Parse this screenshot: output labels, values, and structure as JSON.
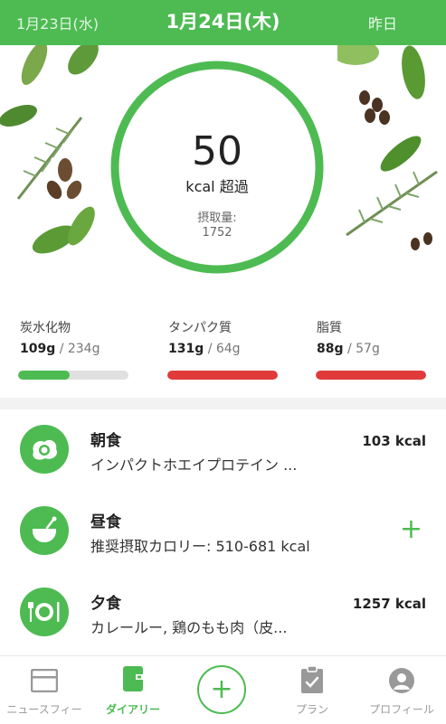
{
  "header": {
    "prev_date": "1月23日(水)",
    "current_date": "1月24日(木)",
    "yesterday_label": "昨日"
  },
  "summary": {
    "value": "50",
    "unit_label": "kcal 超過",
    "intake_label": "摂取量:",
    "intake_value": "1752",
    "ring_color": "#4dbb52"
  },
  "macros": [
    {
      "name": "炭水化物",
      "amount": "109g",
      "goal": " / 234g",
      "progress": 0.47,
      "color": "#4dbb52"
    },
    {
      "name": "タンパク質",
      "amount": "131g",
      "goal": " / 64g",
      "progress": 1.0,
      "color": "#e03a3a"
    },
    {
      "name": "脂質",
      "amount": "88g",
      "goal": " / 57g",
      "progress": 1.0,
      "color": "#e03a3a"
    }
  ],
  "meals": [
    {
      "title": "朝食",
      "subtitle": "インパクトホエイプロテイン ...",
      "kcal": "103 kcal",
      "icon": "egg-icon"
    },
    {
      "title": "昼食",
      "subtitle": "推奨摂取カロリー: 510-681 kcal",
      "action": "+",
      "icon": "bowl-icon"
    },
    {
      "title": "夕食",
      "subtitle": "カレールー, 鶏のもも肉（皮...",
      "kcal": "1257 kcal",
      "icon": "plate-icon"
    }
  ],
  "nav": {
    "items": [
      {
        "label": "ニュースフィー",
        "icon": "newsfeed-icon"
      },
      {
        "label": "ダイアリー",
        "icon": "diary-icon"
      },
      {
        "label": "+",
        "icon": "add-icon"
      },
      {
        "label": "プラン",
        "icon": "clipboard-icon"
      },
      {
        "label": "プロフィール",
        "icon": "profile-icon"
      }
    ]
  }
}
